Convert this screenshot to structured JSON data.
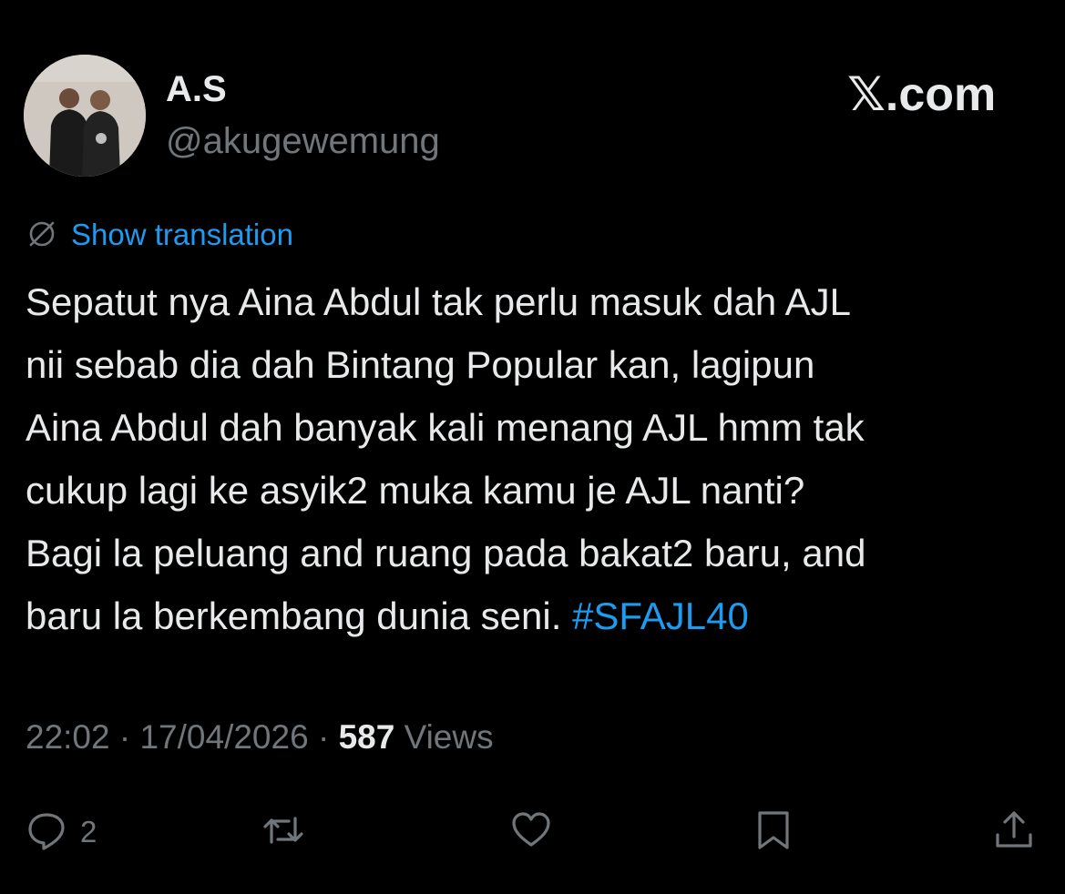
{
  "author": {
    "display_name": "A.S",
    "handle": "@akugewemung",
    "avatar_icon": "profile-photo"
  },
  "site_label": "𝕏.com",
  "translation": {
    "icon": "globe-icon",
    "label": "Show translation"
  },
  "tweet": {
    "text": "Sepatut nya Aina Abdul tak perlu masuk dah AJL\nnii sebab dia dah Bintang Popular kan, lagipun\nAina Abdul dah banyak kali menang AJL hmm tak\ncukup lagi ke asyik2 muka kamu je AJL nanti?\nBagi la peluang and ruang pada bakat2 baru, and\nbaru la berkembang dunia seni.",
    "hashtag": "#SFAJL40"
  },
  "meta": {
    "time": "22:02",
    "separator": " · ",
    "date": "17/04/2026",
    "views_count": "587",
    "views_label": "Views"
  },
  "actions": {
    "reply_count": "2",
    "reply_icon": "reply-icon",
    "retweet_icon": "retweet-icon",
    "like_icon": "heart-icon",
    "bookmark_icon": "bookmark-icon",
    "share_icon": "share-icon"
  },
  "colors": {
    "background": "#000000",
    "text_primary": "#e7e9ea",
    "text_secondary": "#71767b",
    "accent": "#1d9bf0"
  }
}
